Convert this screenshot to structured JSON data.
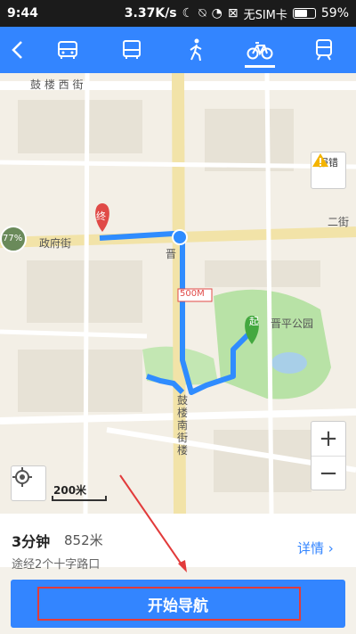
{
  "status_bar": {
    "time": "9:44",
    "speed": "3.37K/s",
    "sim": "无SIM卡",
    "battery": "59%"
  },
  "nav_modes": [
    "back",
    "car",
    "bus",
    "walk",
    "bike",
    "train"
  ],
  "active_mode": "bike",
  "map": {
    "streets": {
      "gulou_west": "鼓 楼 西 街",
      "zhengfu": "政府街",
      "gulou_south": "鼓楼南街楼",
      "erjie": "二街",
      "park": "晋平公园",
      "guang": "晋"
    },
    "report_label": "报错",
    "zoom_in": "+",
    "zoom_out": "−",
    "scale_label": "200米",
    "start_marker": "起",
    "end_marker": "终",
    "speed_limit": "500M",
    "other_marker": "77%"
  },
  "route_info": {
    "duration": "3分钟",
    "distance": "852米",
    "via": "途经2个十字路口",
    "detail_label": "详情"
  },
  "start_nav_label": "开始导航",
  "colors": {
    "accent": "#3385ff",
    "route": "#2f8cff",
    "highlight": "#e23b3b"
  }
}
